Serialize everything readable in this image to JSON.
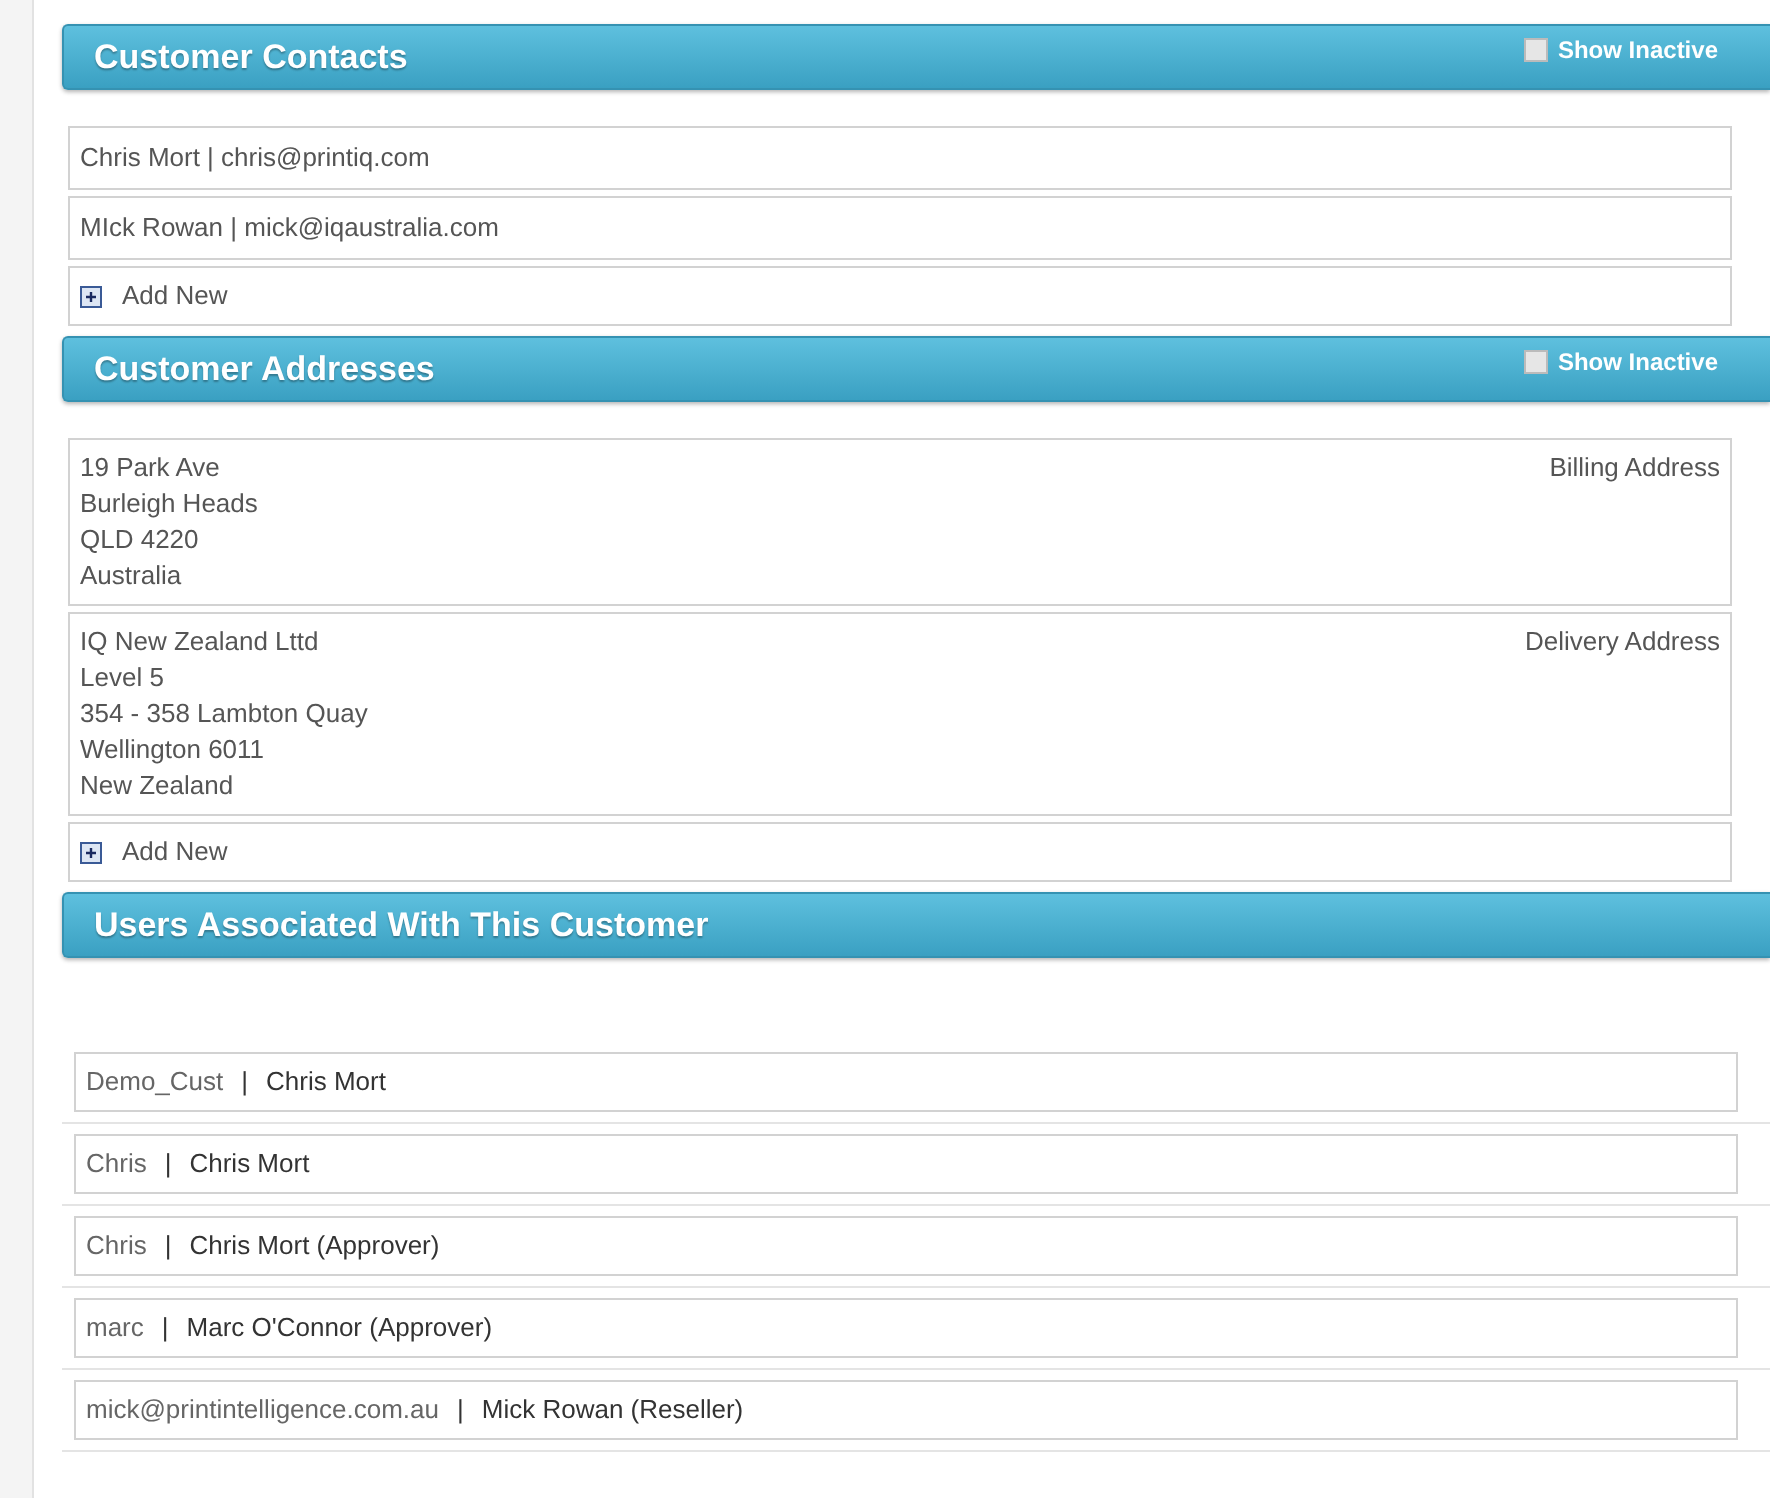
{
  "contacts": {
    "title": "Customer Contacts",
    "show_inactive": {
      "label": "Show Inactive",
      "checked": false
    },
    "items": [
      {
        "text": "Chris Mort | chris@printiq.com"
      },
      {
        "text": "MIck Rowan | mick@iqaustralia.com"
      }
    ],
    "add_new": "Add New"
  },
  "addresses": {
    "title": "Customer Addresses",
    "show_inactive": {
      "label": "Show Inactive",
      "checked": false
    },
    "items": [
      {
        "lines": [
          "19 Park Ave",
          "Burleigh Heads",
          "QLD 4220",
          "Australia"
        ],
        "type": "Billing Address"
      },
      {
        "lines": [
          "IQ New Zealand Lttd",
          "Level 5",
          "354 - 358 Lambton Quay",
          "Wellington 6011",
          "New Zealand"
        ],
        "type": "Delivery Address"
      }
    ],
    "add_new": "Add New"
  },
  "users": {
    "title": "Users Associated With This Customer",
    "items": [
      {
        "username": "Demo_Cust",
        "separator": "|",
        "name": "Chris Mort"
      },
      {
        "username": "Chris",
        "separator": "|",
        "name": "Chris Mort"
      },
      {
        "username": "Chris",
        "separator": "|",
        "name": "Chris Mort (Approver)"
      },
      {
        "username": "marc",
        "separator": "|",
        "name": "Marc O'Connor (Approver)"
      },
      {
        "username": "mick@printintelligence.com.au",
        "separator": "|",
        "name": "Mick Rowan (Reseller)"
      }
    ]
  }
}
